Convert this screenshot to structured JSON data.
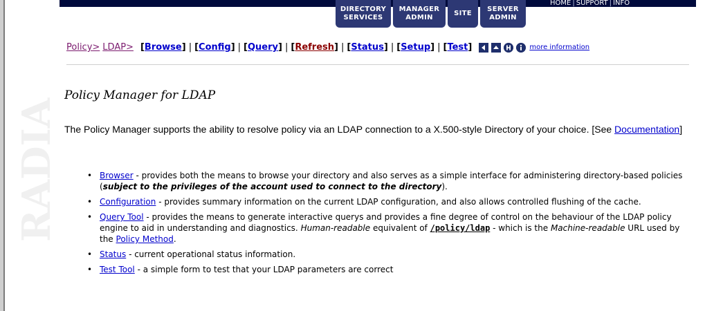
{
  "header": {
    "tabs": [
      {
        "label": "DIRECTORY\nSERVICES"
      },
      {
        "label": "MANAGER\nADMIN"
      },
      {
        "label": "SITE"
      },
      {
        "label": "SERVER\nADMIN"
      }
    ],
    "utility_links": {
      "home": "HOME",
      "support": "SUPPORT",
      "info": "INFO",
      "sep": "|"
    }
  },
  "watermark": {
    "text": "RADIA"
  },
  "breadcrumb": {
    "policy": "Policy>",
    "ldap": "LDAP>"
  },
  "nav": {
    "browse": "Browse",
    "config": "Config",
    "query": "Query",
    "refresh": "Refresh",
    "status": "Status",
    "setup": "Setup",
    "test": "Test",
    "more_info": "more information"
  },
  "icons": [
    "back-icon",
    "up-icon",
    "help-icon",
    "info-icon"
  ],
  "page": {
    "title": "Policy Manager for LDAP",
    "intro_text": "The Policy Manager supports the ability to resolve policy via an LDAP connection to a X.500-style Directory of your choice. [See ",
    "intro_link": "Documentation",
    "intro_end": "]"
  },
  "features": [
    {
      "link": "Browser",
      "text": " - provides both the means to browse your directory and also serves as a simple interface for administering directory-based policies (",
      "emph": "subject to the privileges of the account used to connect to the directory",
      "end": ")."
    },
    {
      "link": "Configuration",
      "text": " - provides summary information on the current LDAP configuration, and also allows controlled flushing of the cache."
    },
    {
      "link": "Query Tool",
      "text": " - provides the means to generate interactive querys and provides a fine degree of control on the behaviour of the LDAP policy engine to aid in understanding and diagnostics. ",
      "em1": "Human-readable",
      "text2": " equivalent of ",
      "code": "/policy/ldap",
      "text3": " - which is the ",
      "em2": "Machine-readable",
      "text4": " URL used by the ",
      "link2": "Policy Method",
      "end": "."
    },
    {
      "link": "Status",
      "text": " - current operational status information."
    },
    {
      "link": "Test Tool",
      "text": " - a simple form to test that your LDAP parameters are correct"
    }
  ],
  "colors": {
    "brand_navy": "#2d3874",
    "topbar": "#000a3c",
    "breadcrumb": "#7b1a6e",
    "link_red": "#8b0000",
    "link_blue": "#0000cc"
  }
}
